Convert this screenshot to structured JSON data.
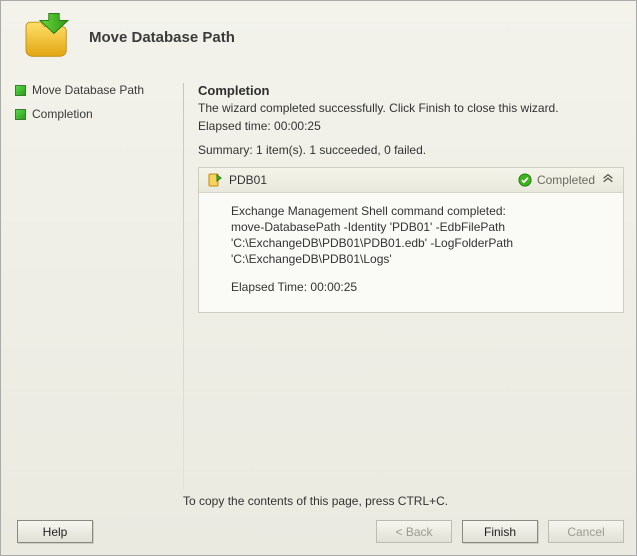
{
  "header": {
    "title": "Move Database Path"
  },
  "sidebar": {
    "steps": [
      {
        "label": "Move Database Path"
      },
      {
        "label": "Completion"
      }
    ]
  },
  "main": {
    "section_title": "Completion",
    "message": "The wizard completed successfully. Click Finish to close this wizard.",
    "elapsed_label": "Elapsed time:",
    "elapsed_value": "00:00:25",
    "summary": "Summary: 1 item(s). 1 succeeded, 0 failed.",
    "item": {
      "name": "PDB01",
      "status": "Completed",
      "body_line1": "Exchange Management Shell command completed:",
      "body_line2": "move-DatabasePath -Identity 'PDB01' -EdbFilePath",
      "body_line3": "'C:\\ExchangeDB\\PDB01\\PDB01.edb' -LogFolderPath",
      "body_line4": "'C:\\ExchangeDB\\PDB01\\Logs'",
      "elapsed_label": "Elapsed Time:",
      "elapsed_value": "00:00:25"
    }
  },
  "footer": {
    "copy_hint": "To copy the contents of this page, press CTRL+C."
  },
  "buttons": {
    "help": "Help",
    "back": "< Back",
    "finish": "Finish",
    "cancel": "Cancel"
  }
}
